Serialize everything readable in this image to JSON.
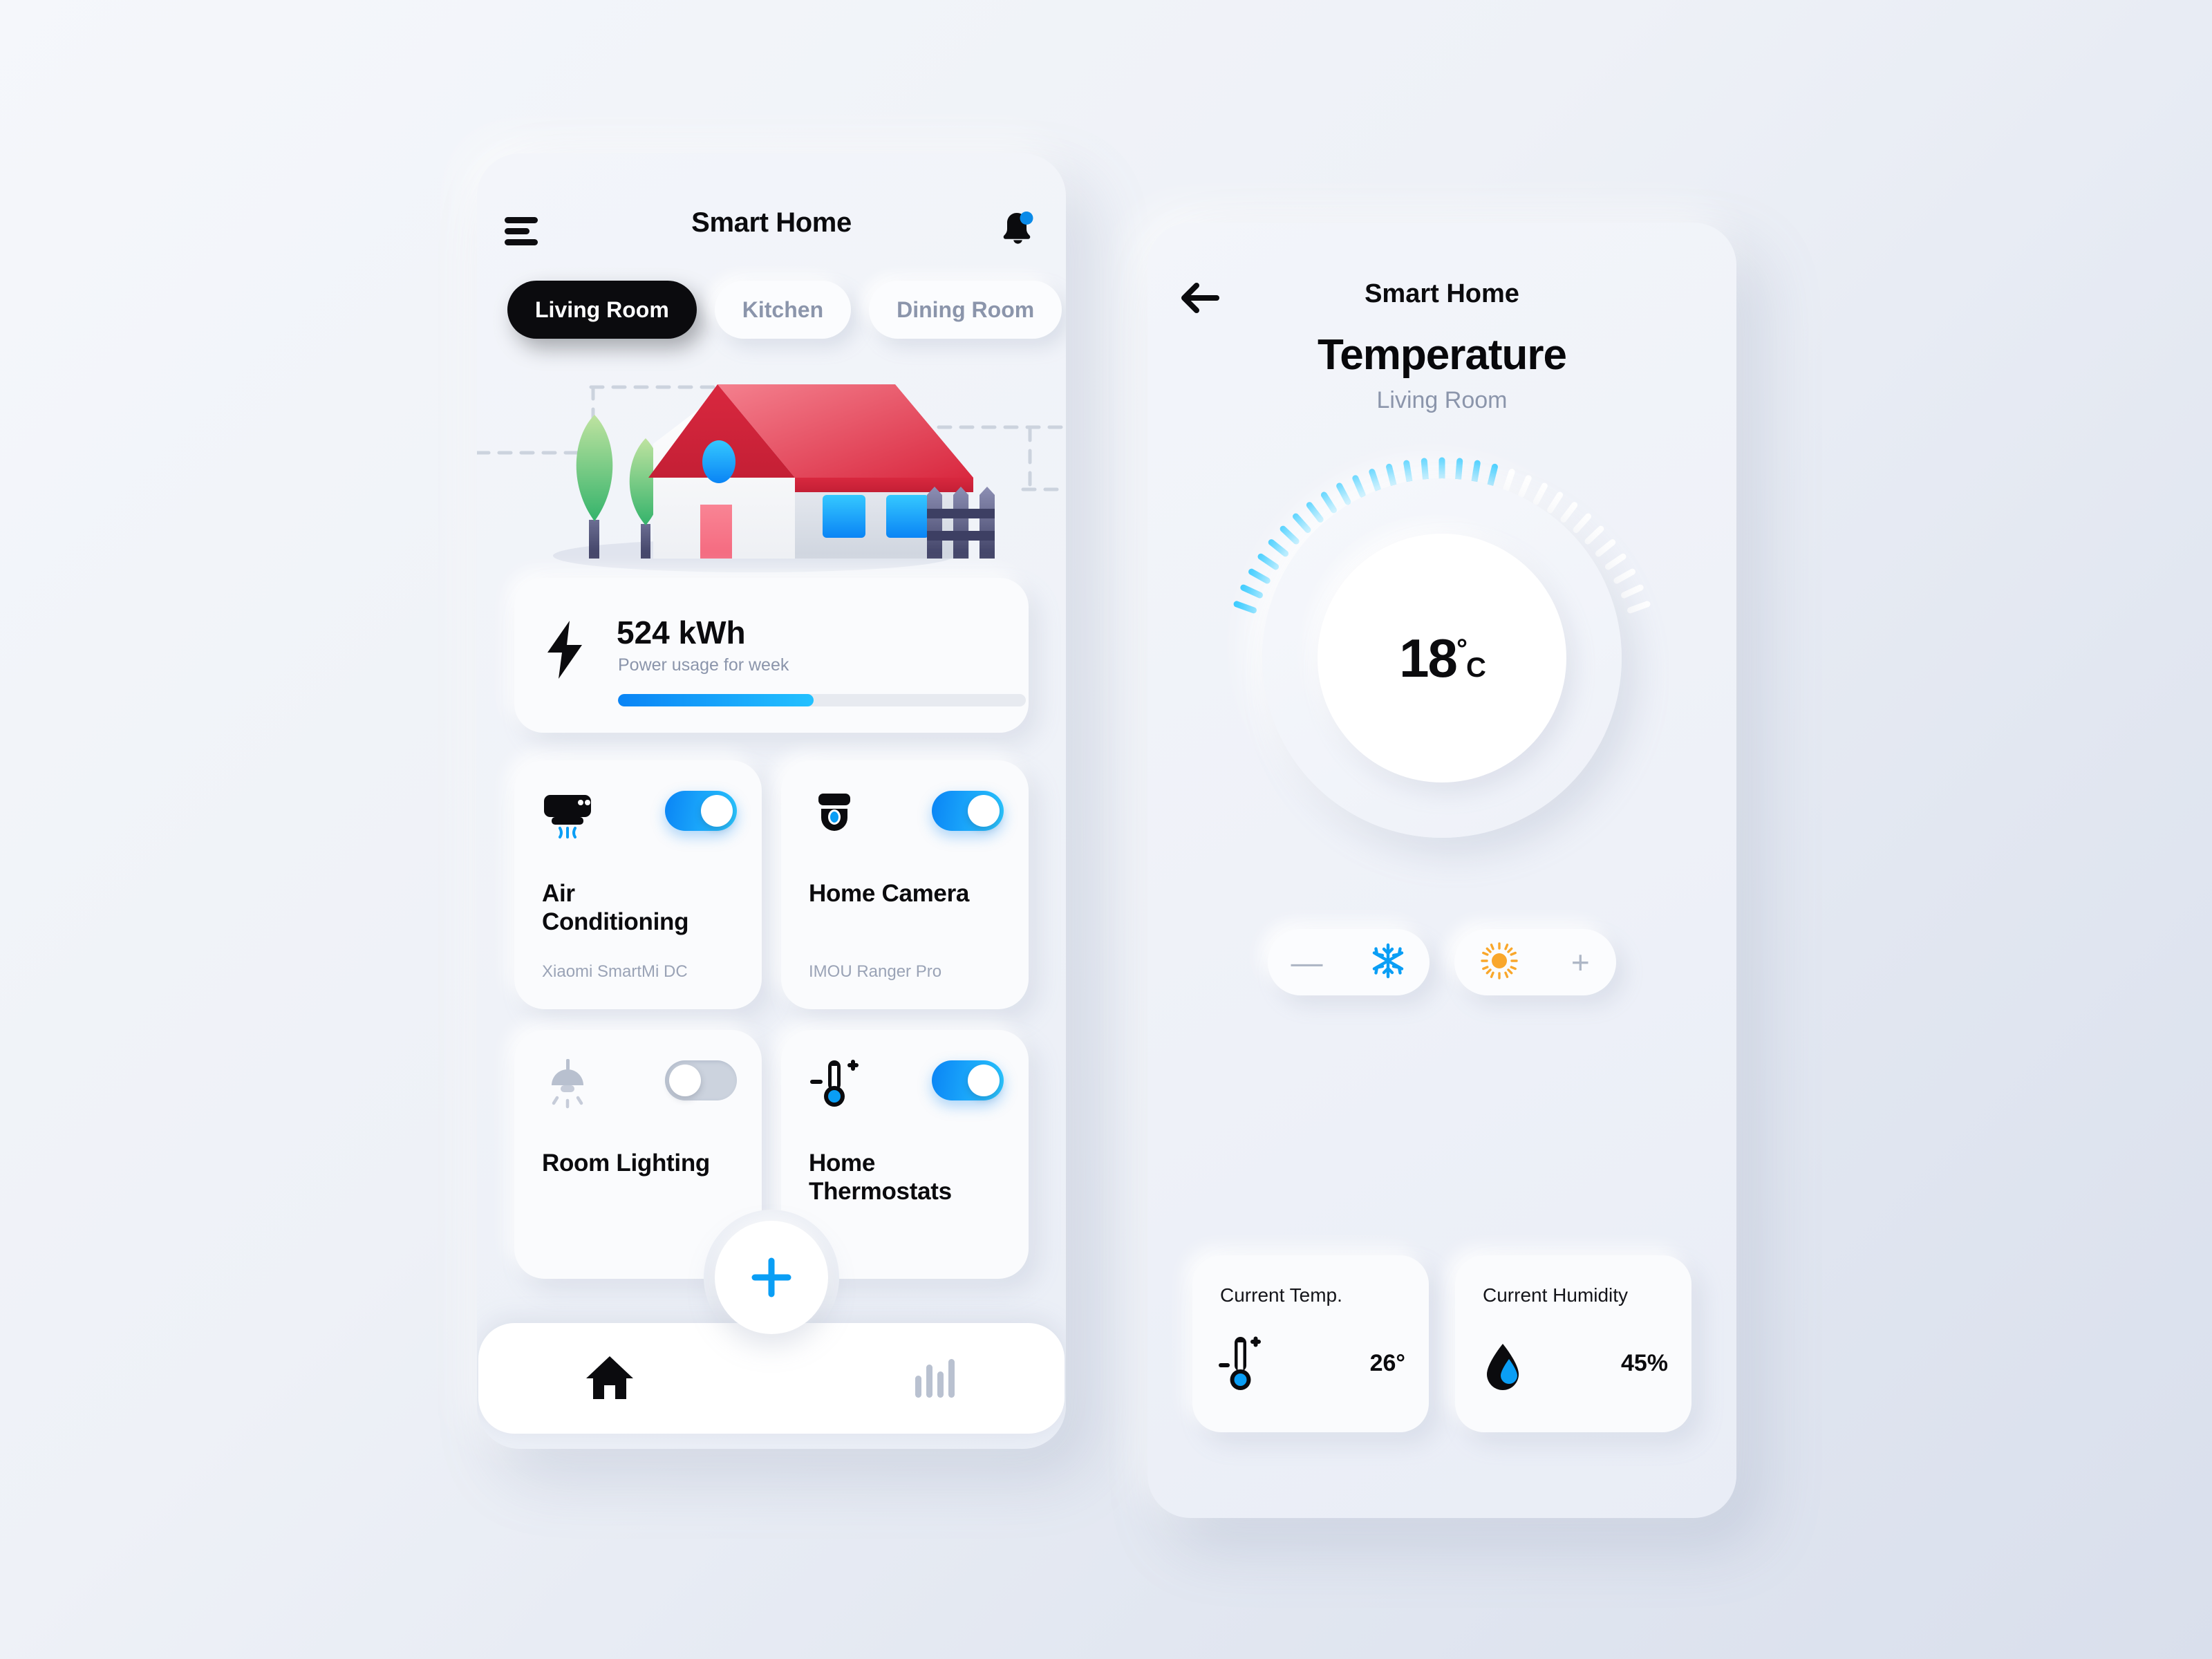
{
  "home_screen": {
    "topbar": {
      "menu_icon": "hamburger-menu-icon",
      "title": "Smart Home",
      "notification_icon": "bell-icon",
      "has_notification_badge": true
    },
    "tabs": [
      {
        "label": "Living Room",
        "active": true
      },
      {
        "label": "Kitchen",
        "active": false
      },
      {
        "label": "Dining Room",
        "active": false
      }
    ],
    "illustration": "house-illustration",
    "power_card": {
      "icon": "lightning-bolt-icon",
      "value": "524 kWh",
      "subtitle": "Power usage for week",
      "progress_percent": 48
    },
    "devices": [
      {
        "icon": "air-conditioner-icon",
        "name": "Air Conditioning",
        "model": "Xiaomi SmartMi DC",
        "state": "on"
      },
      {
        "icon": "security-camera-icon",
        "name": "Home Camera",
        "model": "IMOU Ranger Pro",
        "state": "on"
      },
      {
        "icon": "ceiling-lamp-icon",
        "name": "Room Lighting",
        "model": "",
        "state": "off"
      },
      {
        "icon": "thermometer-icon",
        "name": "Home Thermostats",
        "model": "",
        "state": "on"
      }
    ],
    "fab": {
      "icon": "plus-icon",
      "label": "+"
    },
    "bottom_nav": [
      {
        "icon": "home-icon",
        "active": true
      },
      {
        "icon": "bar-chart-icon",
        "active": false
      }
    ]
  },
  "detail_screen": {
    "back_icon": "arrow-left-icon",
    "title": "Smart Home",
    "heading": "Temperature",
    "room": "Living Room",
    "dial": {
      "value": "18",
      "degree_symbol": "°",
      "unit": "C",
      "total_ticks": 31,
      "active_ticks": 19
    },
    "controls": [
      {
        "minus_label": "—",
        "icon": "snowflake-icon",
        "mode": "cool"
      },
      {
        "icon": "sun-icon",
        "plus_label": "+",
        "mode": "heat"
      }
    ],
    "stats": [
      {
        "label": "Current Temp.",
        "icon": "thermometer-icon",
        "value": "26",
        "unit": "°"
      },
      {
        "label": "Current Humidity",
        "icon": "water-drop-icon",
        "value": "45",
        "unit": "%"
      }
    ]
  },
  "colors": {
    "accent_blue": "#0a84f5",
    "accent_blue_light": "#2ac7ff",
    "sun_orange": "#f9a72b",
    "roof_red": "#e04356",
    "text_dark": "#0b0b0e",
    "text_muted": "#8b95ab",
    "toggle_off": "#ccd3de"
  }
}
